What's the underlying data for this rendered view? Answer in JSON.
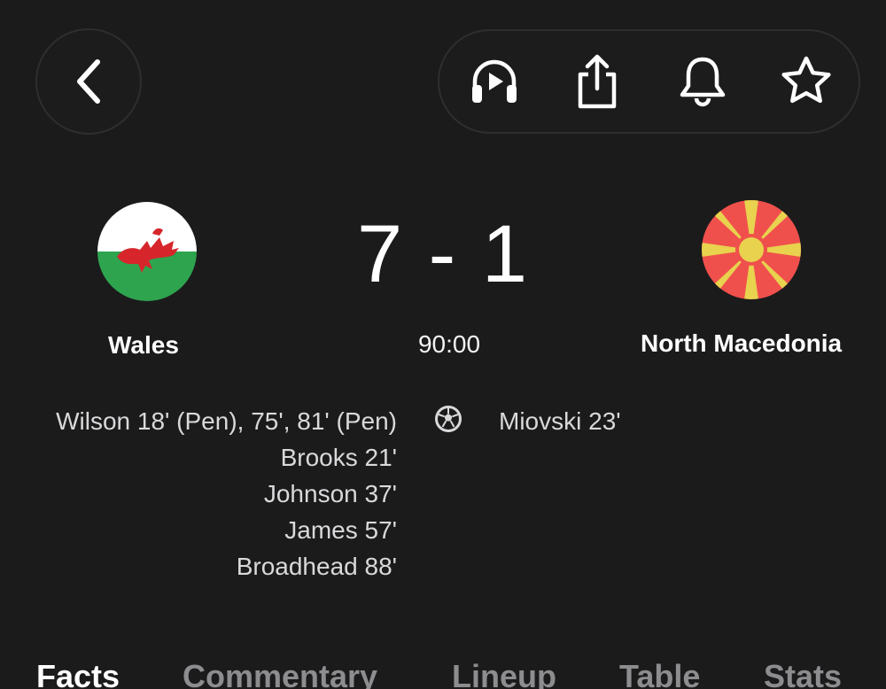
{
  "match": {
    "home": {
      "name": "Wales",
      "score": "7"
    },
    "away": {
      "name": "North Macedonia",
      "score": "1"
    },
    "separator": "-",
    "clock": "90:00"
  },
  "goals": {
    "home": [
      "Wilson 18' (Pen), 75', 81' (Pen)",
      "Brooks 21'",
      "Johnson 37'",
      "James 57'",
      "Broadhead 88'"
    ],
    "away": [
      "Miovski 23'"
    ]
  },
  "tabs": [
    {
      "label": "Facts",
      "active": true
    },
    {
      "label": "Commentary",
      "active": false
    },
    {
      "label": "Lineup",
      "active": false
    },
    {
      "label": "Table",
      "active": false
    },
    {
      "label": "Stats",
      "active": false
    }
  ],
  "icons": {
    "back": "chevron-left-icon",
    "audio": "headphones-play-icon",
    "share": "share-icon",
    "notify": "bell-icon",
    "favorite": "star-icon",
    "goal": "football-icon"
  },
  "colors": {
    "background": "#1b1b1c",
    "active_tab": "#ffffff",
    "inactive_tab": "#8d8d90",
    "scorer_text": "#d9d9db"
  }
}
